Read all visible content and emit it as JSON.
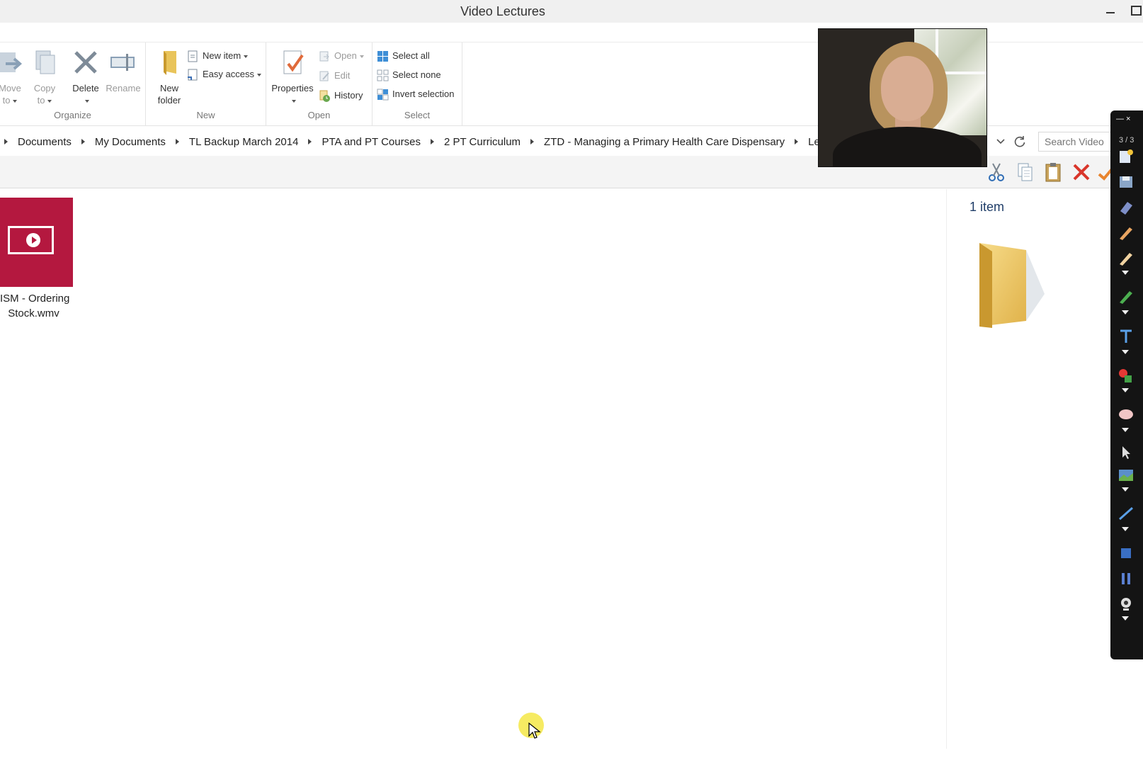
{
  "window": {
    "title": "Video Lectures"
  },
  "ribbon": {
    "organize": {
      "label": "Organize",
      "move_to_line1": "Move",
      "move_to_line2": "to",
      "copy_to_line1": "Copy",
      "copy_to_line2": "to",
      "delete": "Delete",
      "rename": "Rename"
    },
    "new": {
      "label": "New",
      "new_folder_line1": "New",
      "new_folder_line2": "folder",
      "new_item": "New item",
      "easy_access": "Easy access"
    },
    "open": {
      "label": "Open",
      "properties": "Properties",
      "open": "Open",
      "edit": "Edit",
      "history": "History"
    },
    "select": {
      "label": "Select",
      "select_all": "Select all",
      "select_none": "Select none",
      "invert_selection": "Invert selection"
    }
  },
  "address": {
    "crumbs": [
      "Documents",
      "My Documents",
      "TL Backup March 2014",
      "PTA and PT Courses",
      "2 PT Curriculum",
      "ZTD - Managing a Primary Health Care Dispensary",
      "Lectures"
    ],
    "search_placeholder": "Search Video"
  },
  "files": [
    {
      "name_line1": "ISM - Ordering",
      "name_line2": "Stock.wmv",
      "thumb_color": "#b4183f"
    }
  ],
  "details": {
    "count": "1 item"
  },
  "pen_toolbar": {
    "page": "3 / 3"
  },
  "colors": {
    "accent": "#1f3d68",
    "video_thumb": "#b4183f",
    "cursor_highlight": "#f5e846"
  }
}
